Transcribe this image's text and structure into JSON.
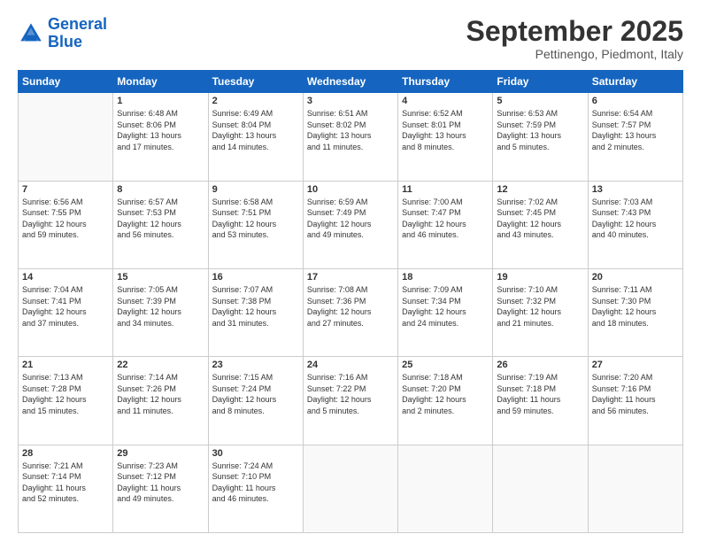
{
  "logo": {
    "line1": "General",
    "line2": "Blue"
  },
  "title": "September 2025",
  "location": "Pettinengo, Piedmont, Italy",
  "days_header": [
    "Sunday",
    "Monday",
    "Tuesday",
    "Wednesday",
    "Thursday",
    "Friday",
    "Saturday"
  ],
  "weeks": [
    [
      {
        "day": "",
        "info": ""
      },
      {
        "day": "1",
        "info": "Sunrise: 6:48 AM\nSunset: 8:06 PM\nDaylight: 13 hours\nand 17 minutes."
      },
      {
        "day": "2",
        "info": "Sunrise: 6:49 AM\nSunset: 8:04 PM\nDaylight: 13 hours\nand 14 minutes."
      },
      {
        "day": "3",
        "info": "Sunrise: 6:51 AM\nSunset: 8:02 PM\nDaylight: 13 hours\nand 11 minutes."
      },
      {
        "day": "4",
        "info": "Sunrise: 6:52 AM\nSunset: 8:01 PM\nDaylight: 13 hours\nand 8 minutes."
      },
      {
        "day": "5",
        "info": "Sunrise: 6:53 AM\nSunset: 7:59 PM\nDaylight: 13 hours\nand 5 minutes."
      },
      {
        "day": "6",
        "info": "Sunrise: 6:54 AM\nSunset: 7:57 PM\nDaylight: 13 hours\nand 2 minutes."
      }
    ],
    [
      {
        "day": "7",
        "info": "Sunrise: 6:56 AM\nSunset: 7:55 PM\nDaylight: 12 hours\nand 59 minutes."
      },
      {
        "day": "8",
        "info": "Sunrise: 6:57 AM\nSunset: 7:53 PM\nDaylight: 12 hours\nand 56 minutes."
      },
      {
        "day": "9",
        "info": "Sunrise: 6:58 AM\nSunset: 7:51 PM\nDaylight: 12 hours\nand 53 minutes."
      },
      {
        "day": "10",
        "info": "Sunrise: 6:59 AM\nSunset: 7:49 PM\nDaylight: 12 hours\nand 49 minutes."
      },
      {
        "day": "11",
        "info": "Sunrise: 7:00 AM\nSunset: 7:47 PM\nDaylight: 12 hours\nand 46 minutes."
      },
      {
        "day": "12",
        "info": "Sunrise: 7:02 AM\nSunset: 7:45 PM\nDaylight: 12 hours\nand 43 minutes."
      },
      {
        "day": "13",
        "info": "Sunrise: 7:03 AM\nSunset: 7:43 PM\nDaylight: 12 hours\nand 40 minutes."
      }
    ],
    [
      {
        "day": "14",
        "info": "Sunrise: 7:04 AM\nSunset: 7:41 PM\nDaylight: 12 hours\nand 37 minutes."
      },
      {
        "day": "15",
        "info": "Sunrise: 7:05 AM\nSunset: 7:39 PM\nDaylight: 12 hours\nand 34 minutes."
      },
      {
        "day": "16",
        "info": "Sunrise: 7:07 AM\nSunset: 7:38 PM\nDaylight: 12 hours\nand 31 minutes."
      },
      {
        "day": "17",
        "info": "Sunrise: 7:08 AM\nSunset: 7:36 PM\nDaylight: 12 hours\nand 27 minutes."
      },
      {
        "day": "18",
        "info": "Sunrise: 7:09 AM\nSunset: 7:34 PM\nDaylight: 12 hours\nand 24 minutes."
      },
      {
        "day": "19",
        "info": "Sunrise: 7:10 AM\nSunset: 7:32 PM\nDaylight: 12 hours\nand 21 minutes."
      },
      {
        "day": "20",
        "info": "Sunrise: 7:11 AM\nSunset: 7:30 PM\nDaylight: 12 hours\nand 18 minutes."
      }
    ],
    [
      {
        "day": "21",
        "info": "Sunrise: 7:13 AM\nSunset: 7:28 PM\nDaylight: 12 hours\nand 15 minutes."
      },
      {
        "day": "22",
        "info": "Sunrise: 7:14 AM\nSunset: 7:26 PM\nDaylight: 12 hours\nand 11 minutes."
      },
      {
        "day": "23",
        "info": "Sunrise: 7:15 AM\nSunset: 7:24 PM\nDaylight: 12 hours\nand 8 minutes."
      },
      {
        "day": "24",
        "info": "Sunrise: 7:16 AM\nSunset: 7:22 PM\nDaylight: 12 hours\nand 5 minutes."
      },
      {
        "day": "25",
        "info": "Sunrise: 7:18 AM\nSunset: 7:20 PM\nDaylight: 12 hours\nand 2 minutes."
      },
      {
        "day": "26",
        "info": "Sunrise: 7:19 AM\nSunset: 7:18 PM\nDaylight: 11 hours\nand 59 minutes."
      },
      {
        "day": "27",
        "info": "Sunrise: 7:20 AM\nSunset: 7:16 PM\nDaylight: 11 hours\nand 56 minutes."
      }
    ],
    [
      {
        "day": "28",
        "info": "Sunrise: 7:21 AM\nSunset: 7:14 PM\nDaylight: 11 hours\nand 52 minutes."
      },
      {
        "day": "29",
        "info": "Sunrise: 7:23 AM\nSunset: 7:12 PM\nDaylight: 11 hours\nand 49 minutes."
      },
      {
        "day": "30",
        "info": "Sunrise: 7:24 AM\nSunset: 7:10 PM\nDaylight: 11 hours\nand 46 minutes."
      },
      {
        "day": "",
        "info": ""
      },
      {
        "day": "",
        "info": ""
      },
      {
        "day": "",
        "info": ""
      },
      {
        "day": "",
        "info": ""
      }
    ]
  ]
}
